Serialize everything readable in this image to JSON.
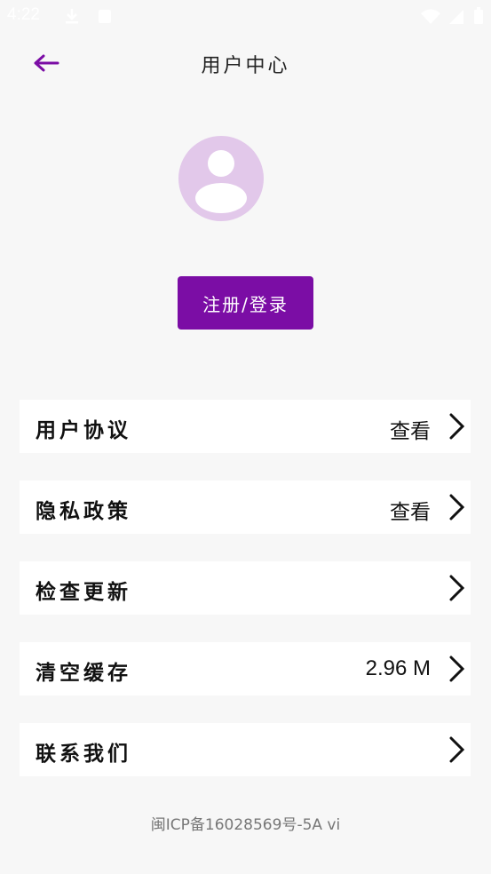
{
  "status_bar": {
    "time": "4:22",
    "left_icons": [
      "download-icon",
      "battery-saver-icon"
    ],
    "right_icons": [
      "wifi-icon",
      "signal-icon",
      "battery-icon"
    ]
  },
  "header": {
    "back_icon": "arrow-left-icon",
    "title": "用户中心"
  },
  "profile": {
    "avatar_icon": "user-avatar-icon",
    "login_button": "注册/登录"
  },
  "menu": [
    {
      "label": "用户协议",
      "value": "查看",
      "icon": "chevron-right-icon"
    },
    {
      "label": "隐私政策",
      "value": "查看",
      "icon": "chevron-right-icon"
    },
    {
      "label": "检查更新",
      "value": "",
      "icon": "chevron-right-icon"
    },
    {
      "label": "清空缓存",
      "value": "2.96 M",
      "icon": "chevron-right-icon"
    },
    {
      "label": "联系我们",
      "value": "",
      "icon": "chevron-right-icon"
    }
  ],
  "footer": {
    "icp": "闽ICP备16028569号-5A vi"
  },
  "colors": {
    "accent": "#7b0da5",
    "avatar_bg": "#e2c8ea",
    "page_bg": "#f7f7f7"
  }
}
